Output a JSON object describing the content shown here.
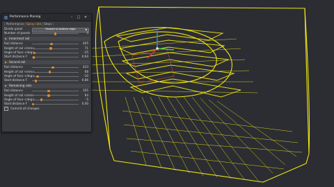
{
  "window": {
    "title": "Performance Planing",
    "minimize": "–",
    "maximize": "□",
    "close": "✕"
  },
  "tabs": [
    {
      "label": "Performance",
      "active": false
    },
    {
      "label": "Spray rails",
      "active": true
    },
    {
      "label": "Steps",
      "active": false
    }
  ],
  "general": {
    "divide_panel": {
      "label": "Divide panel",
      "value": "Parallel to bottom edge"
    },
    "number_of_panels": {
      "label": "Number of panels",
      "value": "3",
      "fraction": 0.5
    }
  },
  "sections": [
    {
      "name": "Innermost rail",
      "rows": [
        {
          "label": "Rail distance",
          "value": "405",
          "fraction": 0.42
        },
        {
          "label": "Height of rail <mm>",
          "value": "71",
          "fraction": 0.4
        },
        {
          "label": "Angle of face <deg>",
          "value": "-15",
          "fraction": 0.05
        },
        {
          "label": "Start distance F",
          "value": "0.64",
          "fraction": 0.04
        }
      ]
    },
    {
      "name": "Second rail",
      "rows": [
        {
          "label": "Rail distance",
          "value": "423",
          "fraction": 0.45
        },
        {
          "label": "Height of rail <mm>",
          "value": "68",
          "fraction": 0.38
        },
        {
          "label": "Angle of face <deg>",
          "value": "-10",
          "fraction": 0.12
        },
        {
          "label": "Start distance F",
          "value": "0.86",
          "fraction": 0.08
        }
      ]
    },
    {
      "name": "Remaining rails",
      "rows": [
        {
          "label": "Rail distance",
          "value": "355",
          "fraction": 0.36
        },
        {
          "label": "Height of rail <mm>",
          "value": "64",
          "fraction": 0.36
        },
        {
          "label": "Angle of face <deg>",
          "value": "-5",
          "fraction": 0.2
        },
        {
          "label": "Start distance F",
          "value": "0.00",
          "fraction": 0.02
        }
      ]
    }
  ],
  "commit": {
    "label": "Commit all changes",
    "checked": true,
    "mark": "✓"
  },
  "colors": {
    "accent": "#e08a2a",
    "wireframe": "#f2e60f",
    "background": "#2b2d33"
  }
}
